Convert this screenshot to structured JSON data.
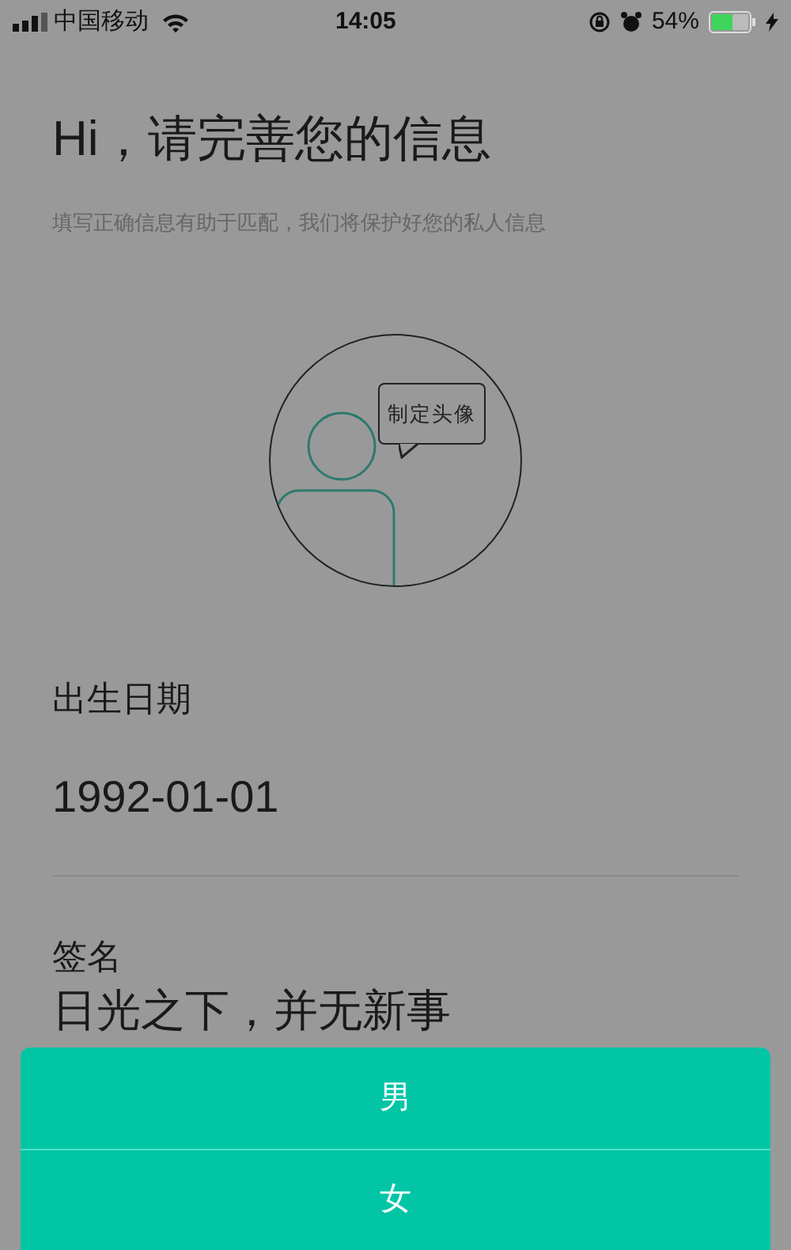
{
  "status_bar": {
    "carrier": "中国移动",
    "time": "14:05",
    "battery": "54%"
  },
  "header": {
    "title": "Hi，请完善您的信息",
    "subtitle": "填写正确信息有助于匹配，我们将保护好您的私人信息"
  },
  "avatar": {
    "button": "制定头像"
  },
  "fields": [
    {
      "label": "出生日期",
      "value": "1992-01-01"
    },
    {
      "label": "签名",
      "value": "日光之下，并无新事"
    }
  ],
  "action_sheet": {
    "options": [
      {
        "label": "男"
      },
      {
        "label": "女"
      }
    ]
  }
}
